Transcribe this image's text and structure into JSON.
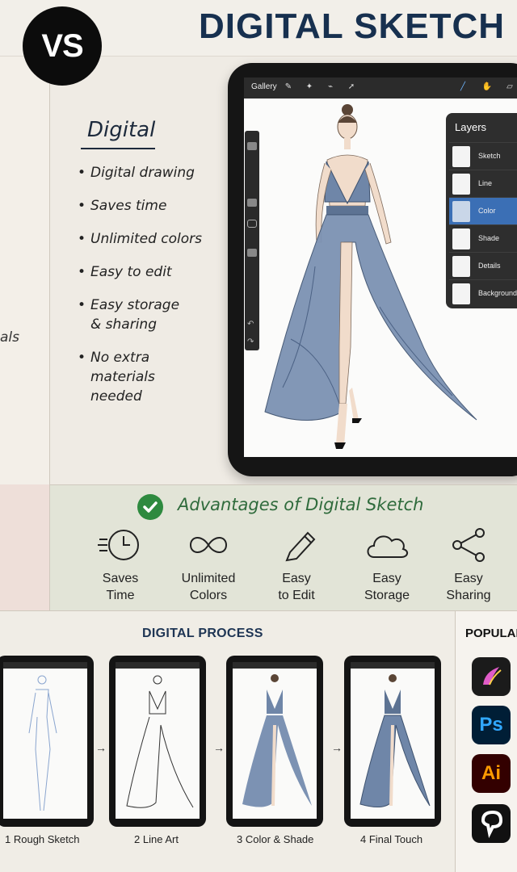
{
  "badge": "VS",
  "title": "DIGITAL SKETCH",
  "left_fragment": "als",
  "digital": {
    "heading": "Digital",
    "features": [
      "Digital drawing",
      "Saves time",
      "Unlimited colors",
      "Easy to edit",
      "Easy storage\n& sharing",
      "No extra\nmaterials\nneeded"
    ]
  },
  "tablet": {
    "gallery_label": "Gallery",
    "layers_title": "Layers",
    "layers": [
      "Sketch",
      "Line",
      "Color",
      "Shade",
      "Details",
      "Background"
    ],
    "selected_layer": "Color"
  },
  "advantages": {
    "title": "Advantages of Digital Sketch",
    "items": [
      {
        "label": "Saves\nTime",
        "icon": "clock-speed-icon"
      },
      {
        "label": "Unlimited\nColors",
        "icon": "infinity-icon"
      },
      {
        "label": "Easy\nto Edit",
        "icon": "pencil-icon"
      },
      {
        "label": "Easy\nStorage",
        "icon": "cloud-icon"
      },
      {
        "label": "Easy\nSharing",
        "icon": "share-icon"
      }
    ]
  },
  "process": {
    "title": "DIGITAL PROCESS",
    "steps": [
      "1 Rough Sketch",
      "2 Line Art",
      "3 Color & Shade",
      "4 Final Touch"
    ]
  },
  "popular": {
    "title": "POPULAR",
    "apps": [
      {
        "icon": "procreate-icon",
        "text": ""
      },
      {
        "icon": "photoshop-icon",
        "text": "Ps"
      },
      {
        "icon": "illustrator-icon",
        "text": "Ai"
      },
      {
        "icon": "clip-studio-icon",
        "text": ""
      }
    ]
  },
  "colors": {
    "title": "#17304f",
    "accent_green": "#2e8a3f",
    "dress_blue": "#6f86a8"
  }
}
